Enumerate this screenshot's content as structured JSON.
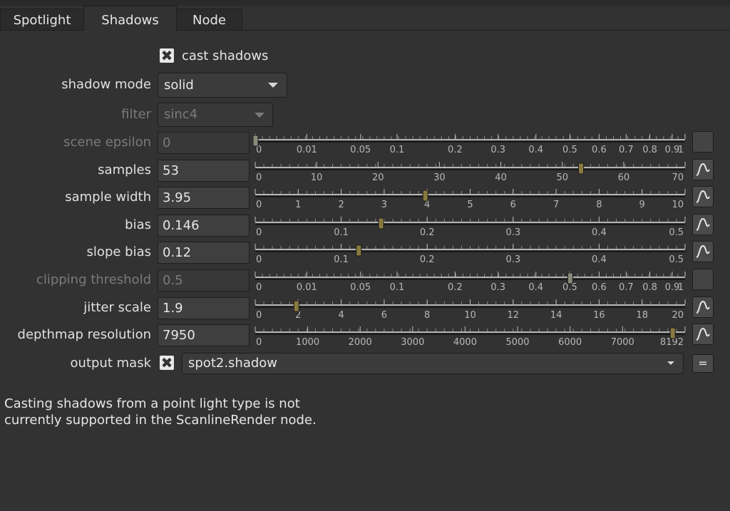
{
  "tabs": [
    {
      "label": "Spotlight",
      "active": false
    },
    {
      "label": "Shadows",
      "active": true
    },
    {
      "label": "Node",
      "active": false
    }
  ],
  "cast_shadows": {
    "checked": true,
    "label": "cast shadows"
  },
  "shadow_mode": {
    "label": "shadow mode",
    "value": "solid"
  },
  "filter": {
    "label": "filter",
    "value": "sinc4",
    "disabled": true
  },
  "knobs": [
    {
      "label": "scene epsilon",
      "value": "0",
      "disabled": true,
      "ticks": [
        "0",
        "0.01",
        "0.05",
        "0.1",
        "0.2",
        "0.3",
        "0.4",
        "0.5",
        "0.6",
        "0.7",
        "0.8",
        "0.9",
        "1"
      ],
      "handle": 0.0
    },
    {
      "label": "samples",
      "value": "53",
      "disabled": false,
      "ticks": [
        "0",
        "10",
        "20",
        "30",
        "40",
        "50",
        "60",
        "70"
      ],
      "handle": 53,
      "range": [
        0,
        70
      ]
    },
    {
      "label": "sample width",
      "value": "3.95",
      "disabled": false,
      "ticks": [
        "0",
        "1",
        "2",
        "3",
        "4",
        "5",
        "6",
        "7",
        "8",
        "9",
        "10"
      ],
      "handle": 3.95,
      "range": [
        0,
        10
      ]
    },
    {
      "label": "bias",
      "value": "0.146",
      "disabled": false,
      "ticks": [
        "0",
        "0.1",
        "0.2",
        "0.3",
        "0.4",
        "0.5"
      ],
      "handle": 0.146,
      "range": [
        0,
        0.5
      ]
    },
    {
      "label": "slope bias",
      "value": "0.12",
      "disabled": false,
      "ticks": [
        "0",
        "0.1",
        "0.2",
        "0.3",
        "0.4",
        "0.5"
      ],
      "handle": 0.12,
      "range": [
        0,
        0.5
      ]
    },
    {
      "label": "clipping threshold",
      "value": "0.5",
      "disabled": true,
      "ticks": [
        "0",
        "0.01",
        "0.05",
        "0.1",
        "0.2",
        "0.3",
        "0.4",
        "0.5",
        "0.6",
        "0.7",
        "0.8",
        "0.9",
        "1"
      ],
      "handle": 0.5
    },
    {
      "label": "jitter scale",
      "value": "1.9",
      "disabled": false,
      "ticks": [
        "0",
        "2",
        "4",
        "6",
        "8",
        "10",
        "12",
        "14",
        "16",
        "18",
        "20"
      ],
      "handle": 1.9,
      "range": [
        0,
        20
      ]
    },
    {
      "label": "depthmap resolution",
      "value": "7950",
      "disabled": false,
      "ticks": [
        "0",
        "1000",
        "2000",
        "3000",
        "4000",
        "5000",
        "6000",
        "7000",
        "8192"
      ],
      "handle": 7950,
      "range": [
        0,
        8192
      ]
    }
  ],
  "output_mask": {
    "label": "output mask",
    "checked": true,
    "value": "spot2.shadow",
    "button_label": "="
  },
  "note": {
    "line1": "Casting shadows from a point light type is not",
    "line2": "currently supported in the ScanlineRender node."
  },
  "colors": {
    "background": "#323232",
    "handle": "#8a7a40",
    "field": "#3f3f3f"
  }
}
